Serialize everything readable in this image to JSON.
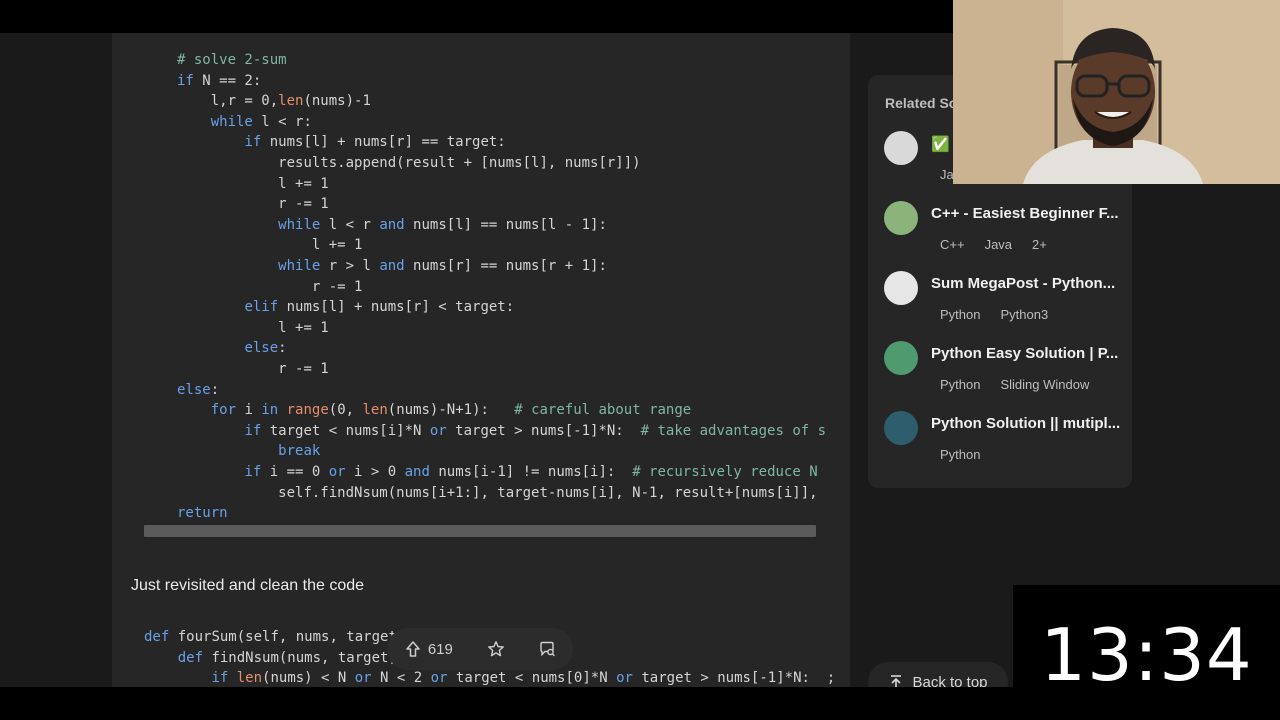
{
  "code_lines": [
    {
      "indent": "",
      "parts": [
        {
          "t": "# solve 2-sum",
          "c": "cm"
        }
      ]
    },
    {
      "indent": "",
      "parts": [
        {
          "t": "if",
          "c": "kw"
        },
        {
          "t": " N == 2:",
          "c": ""
        }
      ]
    },
    {
      "indent": "    ",
      "parts": [
        {
          "t": "l,r = 0,",
          "c": ""
        },
        {
          "t": "len",
          "c": "bi"
        },
        {
          "t": "(nums)-1",
          "c": ""
        }
      ]
    },
    {
      "indent": "    ",
      "parts": [
        {
          "t": "while",
          "c": "kw"
        },
        {
          "t": " l < r:",
          "c": ""
        }
      ]
    },
    {
      "indent": "        ",
      "parts": [
        {
          "t": "if",
          "c": "kw"
        },
        {
          "t": " nums[l] + nums[r] == target:",
          "c": ""
        }
      ]
    },
    {
      "indent": "            ",
      "parts": [
        {
          "t": "results.append(result + [nums[l], nums[r]])",
          "c": ""
        }
      ]
    },
    {
      "indent": "            ",
      "parts": [
        {
          "t": "l += 1",
          "c": ""
        }
      ]
    },
    {
      "indent": "            ",
      "parts": [
        {
          "t": "r -= 1",
          "c": ""
        }
      ]
    },
    {
      "indent": "            ",
      "parts": [
        {
          "t": "while",
          "c": "kw"
        },
        {
          "t": " l < r ",
          "c": ""
        },
        {
          "t": "and",
          "c": "kw"
        },
        {
          "t": " nums[l] == nums[l - 1]:",
          "c": ""
        }
      ]
    },
    {
      "indent": "                ",
      "parts": [
        {
          "t": "l += 1",
          "c": ""
        }
      ]
    },
    {
      "indent": "            ",
      "parts": [
        {
          "t": "while",
          "c": "kw"
        },
        {
          "t": " r > l ",
          "c": ""
        },
        {
          "t": "and",
          "c": "kw"
        },
        {
          "t": " nums[r] == nums[r + 1]:",
          "c": ""
        }
      ]
    },
    {
      "indent": "                ",
      "parts": [
        {
          "t": "r -= 1",
          "c": ""
        }
      ]
    },
    {
      "indent": "        ",
      "parts": [
        {
          "t": "elif",
          "c": "kw"
        },
        {
          "t": " nums[l] + nums[r] < target:",
          "c": ""
        }
      ]
    },
    {
      "indent": "            ",
      "parts": [
        {
          "t": "l += 1",
          "c": ""
        }
      ]
    },
    {
      "indent": "        ",
      "parts": [
        {
          "t": "else",
          "c": "kw"
        },
        {
          "t": ":",
          "c": ""
        }
      ]
    },
    {
      "indent": "            ",
      "parts": [
        {
          "t": "r -= 1",
          "c": ""
        }
      ]
    },
    {
      "indent": "",
      "parts": [
        {
          "t": "else",
          "c": "kw"
        },
        {
          "t": ":",
          "c": ""
        }
      ]
    },
    {
      "indent": "    ",
      "parts": [
        {
          "t": "for",
          "c": "kw"
        },
        {
          "t": " i ",
          "c": ""
        },
        {
          "t": "in",
          "c": "kw"
        },
        {
          "t": " ",
          "c": ""
        },
        {
          "t": "range",
          "c": "bi"
        },
        {
          "t": "(0, ",
          "c": ""
        },
        {
          "t": "len",
          "c": "bi"
        },
        {
          "t": "(nums)-N+1):   ",
          "c": ""
        },
        {
          "t": "# careful about range",
          "c": "cm"
        }
      ]
    },
    {
      "indent": "        ",
      "parts": [
        {
          "t": "if",
          "c": "kw"
        },
        {
          "t": " target < nums[i]*N ",
          "c": ""
        },
        {
          "t": "or",
          "c": "kw"
        },
        {
          "t": " target > nums[-1]*N:  ",
          "c": ""
        },
        {
          "t": "# take advantages of s",
          "c": "cm"
        }
      ]
    },
    {
      "indent": "            ",
      "parts": [
        {
          "t": "break",
          "c": "kw"
        }
      ]
    },
    {
      "indent": "        ",
      "parts": [
        {
          "t": "if",
          "c": "kw"
        },
        {
          "t": " i == 0 ",
          "c": ""
        },
        {
          "t": "or",
          "c": "kw"
        },
        {
          "t": " i > 0 ",
          "c": ""
        },
        {
          "t": "and",
          "c": "kw"
        },
        {
          "t": " nums[i-1] != nums[i]:  ",
          "c": ""
        },
        {
          "t": "# recursively reduce N",
          "c": "cm"
        }
      ]
    },
    {
      "indent": "            ",
      "parts": [
        {
          "t": "self.findNsum(nums[i+1:], target-nums[i], N-1, result+[nums[i]],",
          "c": ""
        }
      ]
    },
    {
      "indent": "",
      "parts": [
        {
          "t": "return",
          "c": "kw"
        }
      ]
    }
  ],
  "note_text": "Just revisited and clean the code",
  "code2_lines": [
    {
      "indent": "",
      "parts": [
        {
          "t": "def",
          "c": "kw"
        },
        {
          "t": " fourSum(self, nums, target)",
          "c": ""
        }
      ]
    },
    {
      "indent": "    ",
      "parts": [
        {
          "t": "def",
          "c": "kw"
        },
        {
          "t": " findNsum(nums, target,",
          "c": ""
        }
      ]
    },
    {
      "indent": "        ",
      "parts": [
        {
          "t": "if",
          "c": "kw"
        },
        {
          "t": " ",
          "c": ""
        },
        {
          "t": "len",
          "c": "bi"
        },
        {
          "t": "(nums) < N ",
          "c": ""
        },
        {
          "t": "or",
          "c": "kw"
        },
        {
          "t": " N < 2 ",
          "c": ""
        },
        {
          "t": "or",
          "c": "kw"
        },
        {
          "t": " target < nums[0]*N ",
          "c": ""
        },
        {
          "t": "or",
          "c": "kw"
        },
        {
          "t": " target > nums[-1]*N:  ;",
          "c": ""
        }
      ]
    }
  ],
  "action_bar": {
    "upvote_count": "619"
  },
  "sidebar": {
    "title": "Related Sc",
    "solutions": [
      {
        "title": "✅ I",
        "tags": [
          "Ja"
        ],
        "avatar_color": "#d9d9d9"
      },
      {
        "title": "C++ - Easiest Beginner F...",
        "tags": [
          "C++",
          "Java",
          "2+"
        ],
        "avatar_color": "#8bb37a"
      },
      {
        "title": "Sum MegaPost - Python...",
        "tags": [
          "Python",
          "Python3"
        ],
        "avatar_color": "#e6e6e6"
      },
      {
        "title": "Python Easy Solution | P...",
        "tags": [
          "Python",
          "Sliding Window"
        ],
        "avatar_color": "#4f9a6e"
      },
      {
        "title": "Python Solution || mutipl...",
        "tags": [
          "Python"
        ],
        "avatar_color": "#2e5e6e"
      }
    ]
  },
  "back_to_top_label": "Back to top",
  "timer_text": "13:34"
}
